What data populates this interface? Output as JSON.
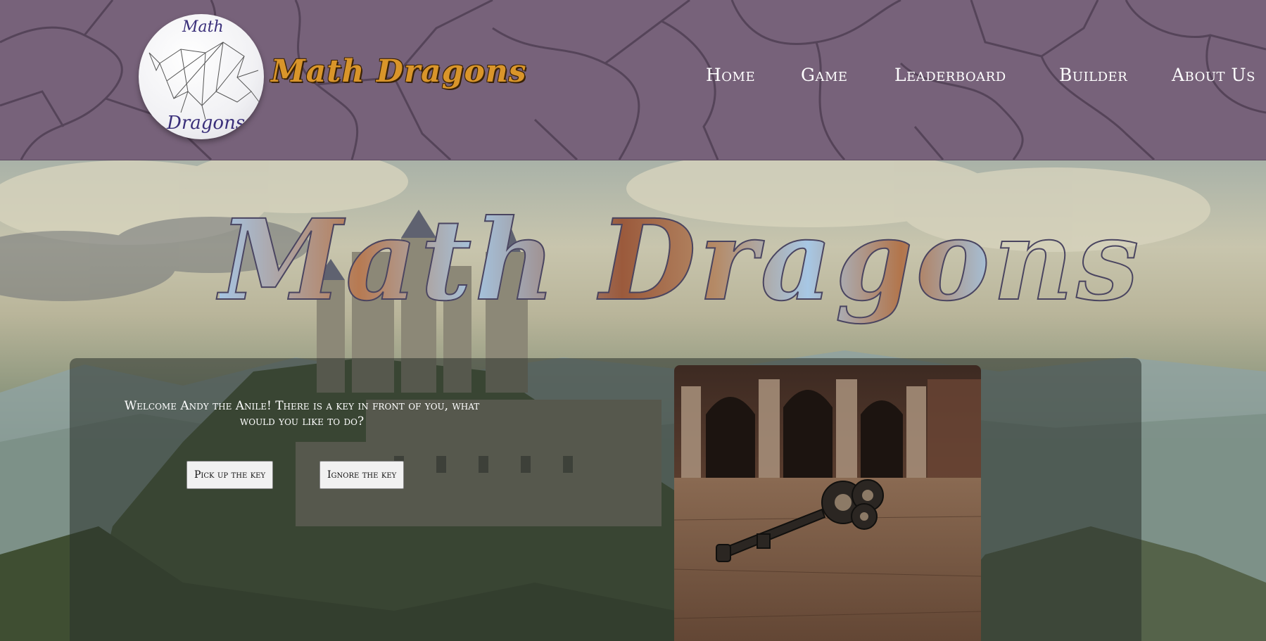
{
  "header": {
    "logo_top_text": "Math",
    "logo_bottom_text": "Dragons",
    "brand_title": "Math Dragons",
    "nav": [
      {
        "label": "Home"
      },
      {
        "label": "Game"
      },
      {
        "label": "Leaderboard"
      },
      {
        "label": "Builder"
      },
      {
        "label": "About Us"
      }
    ]
  },
  "hero": {
    "title": "Math Dragons"
  },
  "story": {
    "text": "Welcome Andy the Anile! There is a key in front of you, what would you like to do?",
    "choices": [
      {
        "label": "Pick up the key"
      },
      {
        "label": "Ignore the key"
      }
    ]
  },
  "colors": {
    "header_bg": "#77627a",
    "brand_gold": "#d9952a",
    "panel_overlay": "rgba(42,50,44,0.55)"
  }
}
